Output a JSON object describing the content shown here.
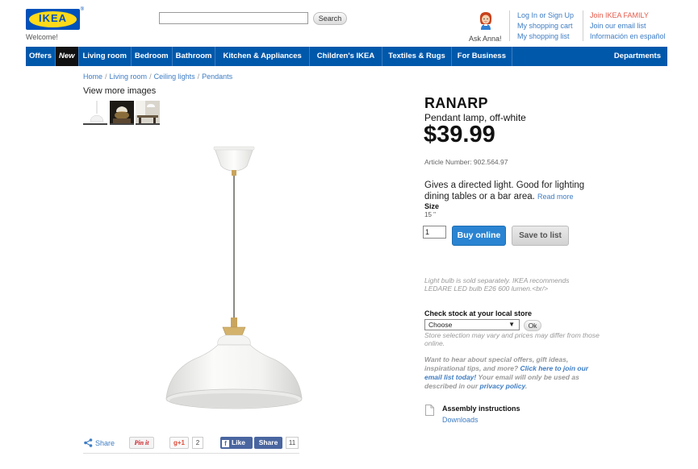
{
  "header": {
    "logo_text": "IKEA",
    "logo_reg": "®",
    "welcome": "Welcome!",
    "search": {
      "placeholder": "",
      "button_label": "Search"
    },
    "ask_anna": "Ask Anna!",
    "account_links": [
      "Log In or Sign Up",
      "My shopping cart",
      "My shopping list"
    ],
    "family_links": [
      "Join IKEA FAMILY",
      "Join our email list",
      "Información en español"
    ]
  },
  "nav": {
    "items": [
      "Offers",
      "New",
      "Living room",
      "Bedroom",
      "Bathroom",
      "Kitchen & Appliances",
      "Children's IKEA",
      "Textiles & Rugs",
      "For Business"
    ],
    "departments": "Departments"
  },
  "breadcrumb": [
    "Home",
    "Living room",
    "Ceiling lights",
    "Pendants"
  ],
  "gallery": {
    "view_more": "View more images"
  },
  "share": {
    "share_label": "Share",
    "pinit_label": "Pin it",
    "gplus_label": "g+1",
    "gplus_count": "2",
    "fb_like_label": "Like",
    "fb_share_label": "Share",
    "fb_count": "11"
  },
  "product": {
    "name": "RANARP",
    "description": "Pendant lamp, off-white",
    "price": "$39.99",
    "article_number": "Article Number: 902.564.97",
    "blurb": "Gives a directed light. Good for lighting dining tables or a bar area.",
    "read_more": "Read more",
    "size_label": "Size",
    "size_value": "15 \"",
    "quantity": "1",
    "buy_label": "Buy online",
    "save_label": "Save to list",
    "bulb_note": "Light bulb is sold separately. IKEA recommends LEDARE LED bulb E26 600 lumen.<br/>"
  },
  "stock": {
    "title": "Check stock at your local store",
    "select_value": "Choose",
    "ok_label": "Ok",
    "note": "Store selection may vary and prices may differ from those online."
  },
  "offers": {
    "text_before": "Want to hear about special offers, gift ideas, inspirational tips, and more? ",
    "link1": "Click here to join our email list today!",
    "text_middle": " Your email will only be used as described in our ",
    "link2": "privacy policy",
    "text_after": "."
  },
  "assembly": {
    "title": "Assembly instructions",
    "downloads": "Downloads"
  },
  "colors": {
    "nav_blue": "#0058ab",
    "link_blue": "#3e7dc4",
    "buy_blue": "#2a84d2",
    "logo_yellow": "#ffda1a",
    "logo_blue": "#0051ba",
    "family_red": "#e45a4a"
  }
}
